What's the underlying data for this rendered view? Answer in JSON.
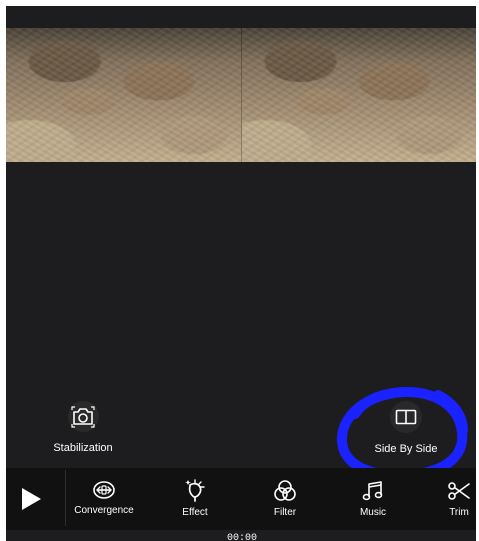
{
  "editor": {
    "tools": {
      "stabilization_label": "Stabilization",
      "side_by_side_label": "Side By Side"
    },
    "toolbar": {
      "items": [
        {
          "label": "Convergence",
          "icon": "convergence-icon"
        },
        {
          "label": "Effect",
          "icon": "effect-icon"
        },
        {
          "label": "Filter",
          "icon": "filter-icon"
        },
        {
          "label": "Music",
          "icon": "music-icon"
        },
        {
          "label": "Trim",
          "icon": "scissors-icon"
        }
      ]
    },
    "timecode": "00:00",
    "colors": {
      "background": "#1d1d1f",
      "toolbar": "#111111",
      "text": "#ffffff",
      "highlight": "#1a22ff"
    }
  }
}
